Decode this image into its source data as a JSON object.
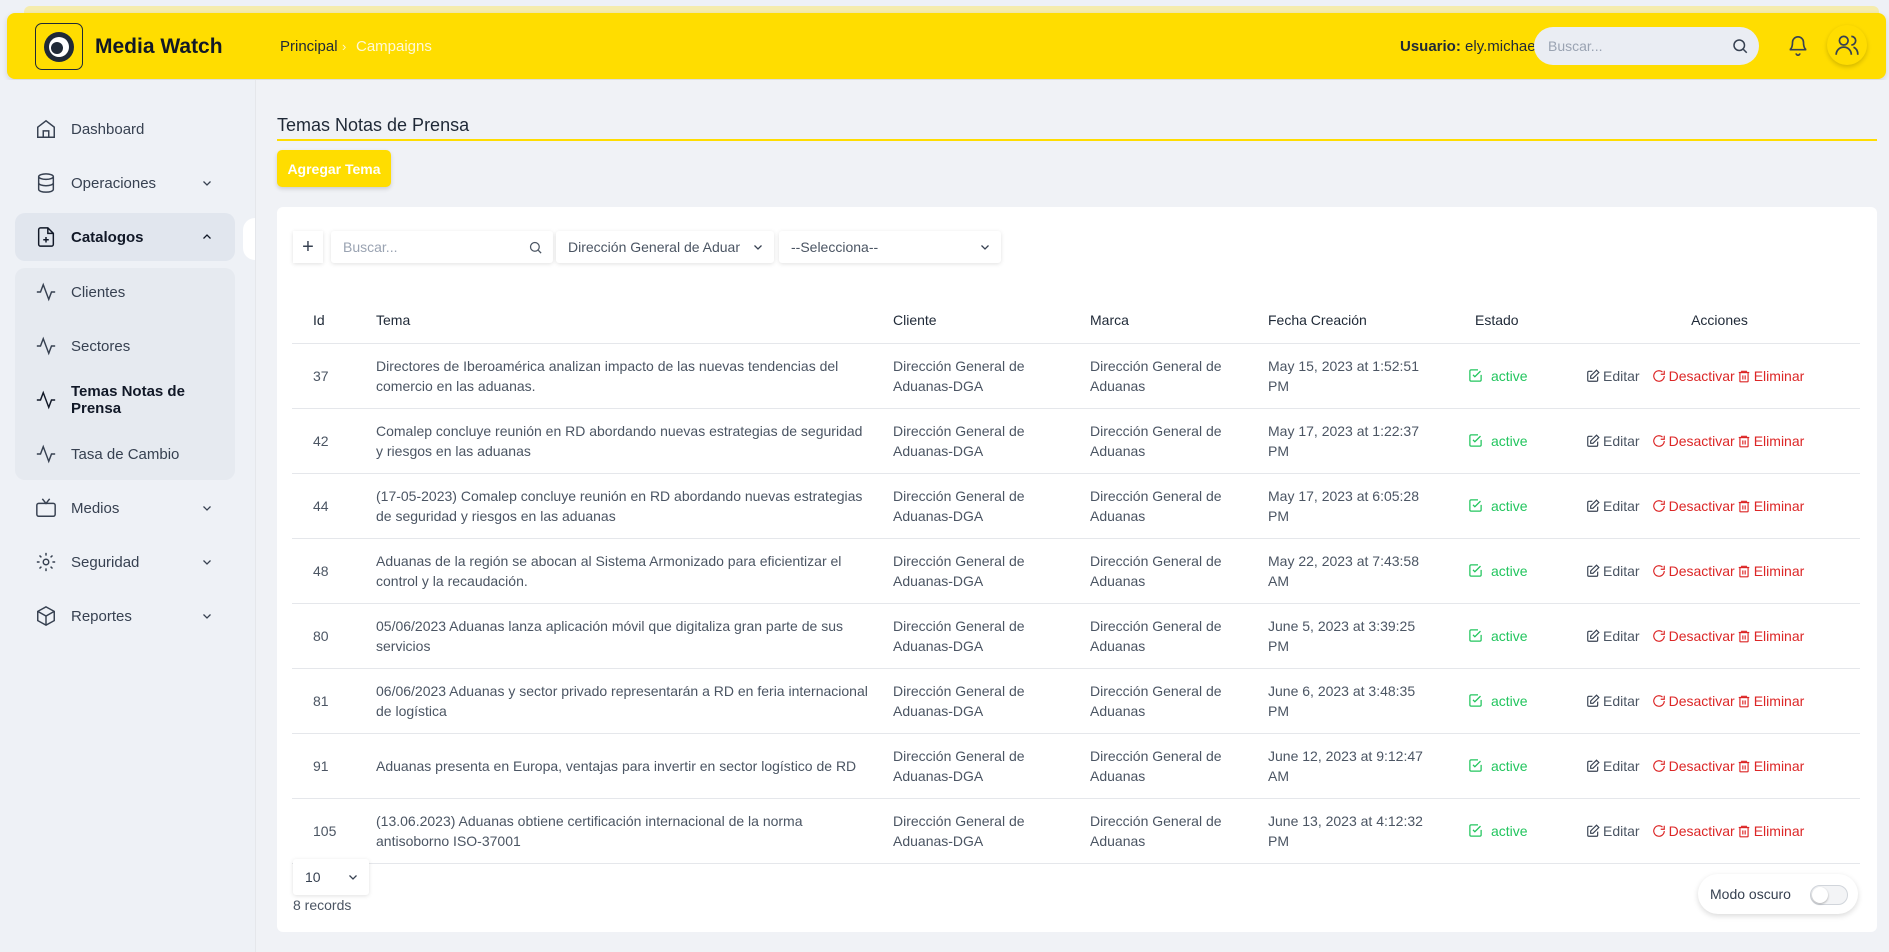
{
  "app": {
    "title": "Media Watch"
  },
  "breadcrumb": {
    "home": "Principal",
    "current": "Campaigns"
  },
  "header": {
    "user_label": "Usuario:",
    "user_name": "ely.michael",
    "search_placeholder": "Buscar..."
  },
  "sidebar": {
    "items": [
      {
        "label": "Dashboard",
        "icon": "home-icon"
      },
      {
        "label": "Operaciones",
        "icon": "database-icon"
      },
      {
        "label": "Catalogos",
        "icon": "file-plus-icon"
      },
      {
        "label": "Medios",
        "icon": "tv-icon"
      },
      {
        "label": "Seguridad",
        "icon": "gear-icon"
      },
      {
        "label": "Reportes",
        "icon": "box-icon"
      }
    ],
    "catalog_sub": [
      {
        "label": "Clientes",
        "icon": "activity-icon"
      },
      {
        "label": "Sectores",
        "icon": "activity-icon"
      },
      {
        "label": "Temas Notas de Prensa",
        "icon": "activity-icon"
      },
      {
        "label": "Tasa de Cambio",
        "icon": "activity-icon"
      }
    ]
  },
  "page": {
    "title": "Temas Notas de Prensa",
    "add_button": "Agregar Tema"
  },
  "toolbar": {
    "search_placeholder": "Buscar...",
    "client_select": "Dirección General de Aduanas-DGA",
    "brand_select": "--Selecciona--"
  },
  "table": {
    "columns": [
      "Id",
      "Tema",
      "Cliente",
      "Marca",
      "Fecha Creación",
      "Estado",
      "Acciones"
    ],
    "rows": [
      {
        "id": "37",
        "tema": "Directores de Iberoamérica analizan impacto de las nuevas tendencias del comercio en las aduanas.",
        "cliente": "Dirección General de Aduanas-DGA",
        "marca": "Dirección General de Aduanas",
        "fecha": "May 15, 2023 at 1:52:51 PM",
        "estado": "active"
      },
      {
        "id": "42",
        "tema": "Comalep concluye reunión en RD abordando nuevas estrategias de seguridad y riesgos en las aduanas",
        "cliente": "Dirección General de Aduanas-DGA",
        "marca": "Dirección General de Aduanas",
        "fecha": "May 17, 2023 at 1:22:37 PM",
        "estado": "active"
      },
      {
        "id": "44",
        "tema": "(17-05-2023) Comalep concluye reunión en RD abordando nuevas estrategias de seguridad y riesgos en las aduanas",
        "cliente": "Dirección General de Aduanas-DGA",
        "marca": "Dirección General de Aduanas",
        "fecha": "May 17, 2023 at 6:05:28 PM",
        "estado": "active"
      },
      {
        "id": "48",
        "tema": "Aduanas de la región se abocan al Sistema Armonizado para eficientizar el control y la recaudación.",
        "cliente": "Dirección General de Aduanas-DGA",
        "marca": "Dirección General de Aduanas",
        "fecha": "May 22, 2023 at 7:43:58 AM",
        "estado": "active"
      },
      {
        "id": "80",
        "tema": "05/06/2023 Aduanas lanza aplicación móvil que digitaliza gran parte de sus servicios",
        "cliente": "Dirección General de Aduanas-DGA",
        "marca": "Dirección General de Aduanas",
        "fecha": "June 5, 2023 at 3:39:25 PM",
        "estado": "active"
      },
      {
        "id": "81",
        "tema": "06/06/2023 Aduanas y sector privado representarán a RD en feria internacional de logística",
        "cliente": "Dirección General de Aduanas-DGA",
        "marca": "Dirección General de Aduanas",
        "fecha": "June 6, 2023 at 3:48:35 PM",
        "estado": "active"
      },
      {
        "id": "91",
        "tema": "Aduanas presenta en Europa, ventajas para invertir en sector logístico de RD",
        "cliente": "Dirección General de Aduanas-DGA",
        "marca": "Dirección General de Aduanas",
        "fecha": "June 12, 2023 at 9:12:47 AM",
        "estado": "active"
      },
      {
        "id": "105",
        "tema": "(13.06.2023) Aduanas obtiene certificación internacional de la norma antisoborno ISO-37001",
        "cliente": "Dirección General de Aduanas-DGA",
        "marca": "Dirección General de Aduanas",
        "fecha": "June 13, 2023 at 4:12:32 PM",
        "estado": "active"
      }
    ],
    "actions": {
      "edit": "Editar",
      "deactivate": "Desactivar",
      "delete": "Eliminar"
    }
  },
  "footer": {
    "page_size": "10",
    "records": "8 records",
    "dark_mode_label": "Modo oscuro"
  },
  "colors": {
    "accent": "#ffdd00",
    "status_active": "#22c55e",
    "danger": "#dc2626"
  }
}
